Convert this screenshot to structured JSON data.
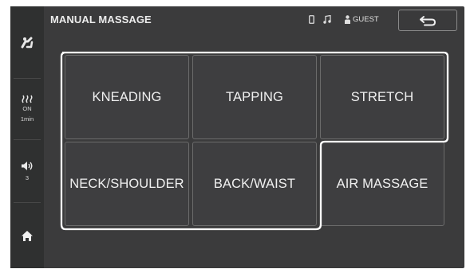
{
  "header": {
    "title": "MANUAL MASSAGE",
    "user_label": "GUEST"
  },
  "sidebar": {
    "heat": {
      "status": "ON",
      "time": "1min"
    },
    "volume": {
      "level": "3"
    }
  },
  "tiles": {
    "kneading": "KNEADING",
    "tapping": "TAPPING",
    "stretch": "STRETCH",
    "neck_shoulder": "NECK/SHOULDER",
    "back_waist": "BACK/WAIST",
    "air_massage": "AIR MASSAGE"
  },
  "icons": {
    "sidebar_top": "recline-seat-icon",
    "heat": "heat-waves-icon",
    "volume": "speaker-icon",
    "home": "home-icon",
    "phone": "phone-icon",
    "music": "music-note-icon",
    "user": "user-icon",
    "back": "back-arrow-icon"
  },
  "colors": {
    "background": "#3b3b3c",
    "sidebar": "#2f3030",
    "tile": "#3e3e40",
    "highlight_outline": "#ffffff"
  }
}
